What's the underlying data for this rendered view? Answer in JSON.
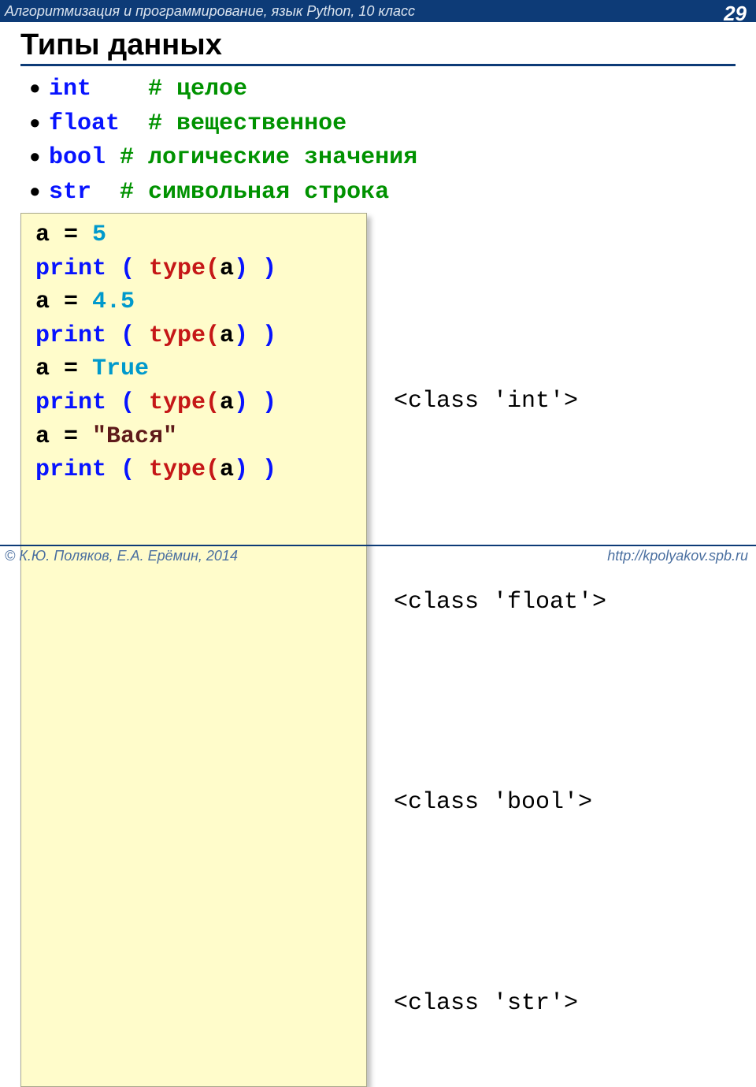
{
  "header": {
    "breadcrumb": "Алгоритмизация и программирование, язык Python, 10 класс",
    "page": "29"
  },
  "title": "Типы данных",
  "types": [
    {
      "kw": "int",
      "cmt": "# целое"
    },
    {
      "kw": "float",
      "cmt": "# вещественное"
    },
    {
      "kw": "bool",
      "cmt": "   # логические значения"
    },
    {
      "kw": "str",
      "cmt": "# символьная строка"
    }
  ],
  "code": {
    "l1_a": "a = ",
    "l1_val": "5",
    "print_open": "print ( ",
    "type_open": "type(",
    "type_arg": "a",
    "type_close": ") )",
    "l3_a": "a = ",
    "l3_val": "4.5",
    "l5_a": "a = ",
    "l5_val": "True",
    "l7_a": "a = ",
    "l7_val": "\"Вася\""
  },
  "outputs": {
    "o1": "<class 'int'>",
    "o2": "<class 'float'>",
    "o3": "<class 'bool'>",
    "o4": "<class 'str'>"
  },
  "footer": {
    "left": "© К.Ю. Поляков, Е.А. Ерёмин, 2014",
    "right": "http://kpolyakov.spb.ru"
  }
}
